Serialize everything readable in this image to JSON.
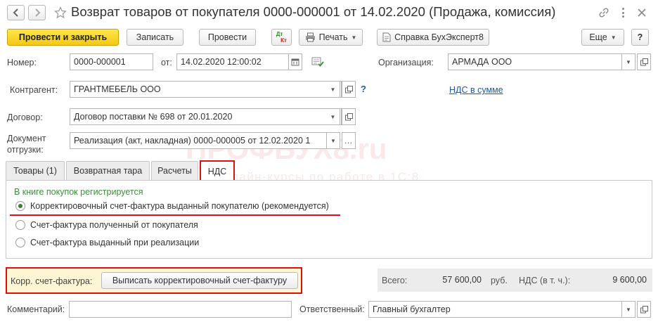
{
  "window": {
    "title": "Возврат товаров от покупателя 0000-000001 от 14.02.2020 (Продажа, комиссия)"
  },
  "toolbar": {
    "post_close_label": "Провести и закрыть",
    "save_label": "Записать",
    "post_label": "Провести",
    "dtkt_label_top": "Дт",
    "dtkt_label_bottom": "Кт",
    "print_label": "Печать",
    "help_label": "Справка БухЭксперт8",
    "more_label": "Еще",
    "question_label": "?"
  },
  "form": {
    "number_label": "Номер:",
    "number_value": "0000-000001",
    "date_label": "от:",
    "date_value": "14.02.2020 12:00:02",
    "org_label": "Организация:",
    "org_value": "АРМАДА ООО",
    "counterparty_label": "Контрагент:",
    "counterparty_value": "ГРАНТМЕБЕЛЬ ООО",
    "vat_link": "НДС в сумме",
    "contract_label": "Договор:",
    "contract_value": "Договор поставки № 698 от 20.01.2020",
    "shipment_label_1": "Документ",
    "shipment_label_2": "отгрузки:",
    "shipment_value": "Реализация (акт, накладная) 0000-000005 от 12.02.2020 1",
    "comment_label": "Комментарий:",
    "comment_value": "",
    "responsible_label": "Ответственный:",
    "responsible_value": "Главный бухгалтер"
  },
  "watermark": {
    "main": "ПРОФБУХ8.ru",
    "sub": "онлайн-курсы по работе в 1С:8"
  },
  "tabs": [
    {
      "label": "Товары (1)"
    },
    {
      "label": "Возвратная тара"
    },
    {
      "label": "Расчеты"
    },
    {
      "label": "НДС"
    }
  ],
  "vat_tab": {
    "group_title": "В книге покупок регистрируется",
    "options": [
      {
        "label": "Корректировочный счет-фактура выданный покупателю (рекомендуется)",
        "selected": true
      },
      {
        "label": "Счет-фактура полученный от покупателя",
        "selected": false
      },
      {
        "label": "Счет-фактура выданный при реализации",
        "selected": false
      }
    ]
  },
  "invoice": {
    "label": "Корр. счет-фактура:",
    "button_label": "Выписать корректировочный счет-фактуру"
  },
  "totals": {
    "total_label": "Всего:",
    "total_value": "57 600,00",
    "currency": "руб.",
    "vat_label": "НДС (в т. ч.):",
    "vat_value": "9 600,00"
  },
  "colors": {
    "accent_yellow": "#f5c913",
    "highlight_red": "#e01010",
    "group_title_green": "#3a8f3a",
    "link_blue": "#1a5aa8",
    "invoice_bg": "#fdf5d3"
  },
  "icons": {
    "back": "arrow-left-icon",
    "forward": "arrow-right-icon",
    "favorite": "star-icon",
    "link": "link-icon",
    "more": "kebab-icon",
    "close": "close-icon"
  }
}
